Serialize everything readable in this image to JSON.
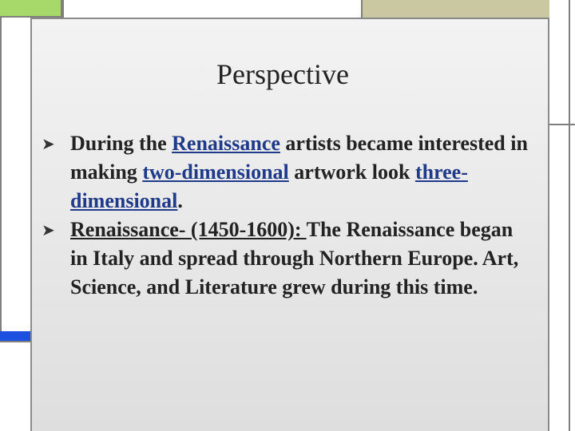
{
  "slide": {
    "title": "Perspective",
    "bullets": [
      {
        "marker_icon": "arrowhead-bullet",
        "parts": {
          "t1": "During the ",
          "link1": "Renaissance",
          "t2": " artists became interested in making ",
          "link2": "two-dimensional",
          "t3": " artwork look ",
          "link3": "three-dimensional",
          "t4": "."
        }
      },
      {
        "marker_icon": "arrowhead-bullet",
        "parts": {
          "u1": "Renaissance- (1450-1600): ",
          "t1": "The Renaissance began in Italy and spread through Northern Europe. Art, Science, and Literature grew during this time."
        }
      }
    ]
  },
  "colors": {
    "accent_green": "#a6d86a",
    "accent_olive": "#c9c8a0",
    "accent_blue": "#1d4fe0",
    "link_blue": "#1f3a8a"
  }
}
